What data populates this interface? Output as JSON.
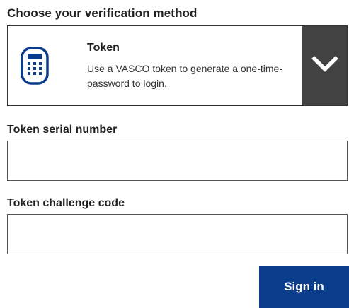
{
  "section": {
    "title": "Choose your verification method"
  },
  "method": {
    "name": "Token",
    "description": "Use a VASCO token to generate a one-time-password to login.",
    "icon": "token-device-icon",
    "toggle_icon": "chevron-down-icon"
  },
  "fields": {
    "serial": {
      "label": "Token serial number",
      "value": "",
      "placeholder": ""
    },
    "challenge": {
      "label": "Token challenge code",
      "value": "",
      "placeholder": ""
    }
  },
  "actions": {
    "signin_label": "Sign in"
  },
  "colors": {
    "accent_icon": "#0a3c8c",
    "button_bg": "#0a3c8c",
    "toggle_bg": "#424242"
  }
}
